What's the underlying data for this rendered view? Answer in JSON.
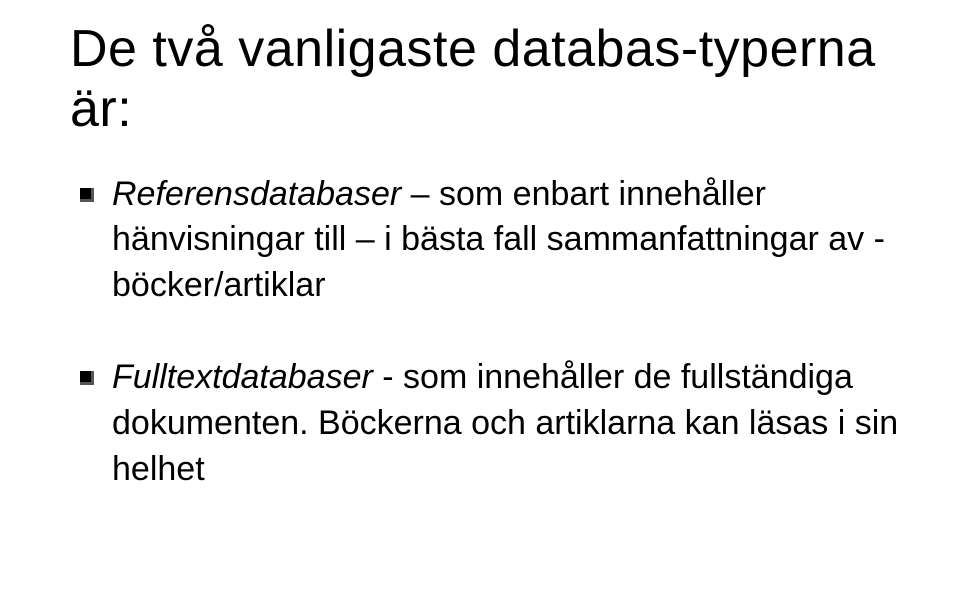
{
  "title": "De två vanligaste databas-typerna är:",
  "bullets": [
    {
      "term": "Referensdatabaser",
      "connector": " – ",
      "desc": "som enbart innehåller hänvisningar till – i bästa fall sammanfattningar av - böcker/artiklar"
    },
    {
      "term": "Fulltextdatabaser",
      "connector": " - ",
      "desc": "som innehåller de fullständiga dokumenten. Böckerna och artiklarna kan läsas i sin helhet"
    }
  ]
}
